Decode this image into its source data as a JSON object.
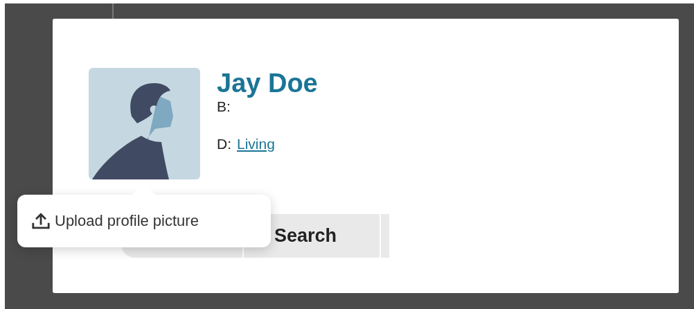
{
  "profile": {
    "name": "Jay Doe",
    "birth_label": "B:",
    "death_label": "D:",
    "death_value": "Living"
  },
  "actions": [
    {
      "label": "Search"
    }
  ],
  "tooltip": {
    "text": "Upload profile picture"
  }
}
